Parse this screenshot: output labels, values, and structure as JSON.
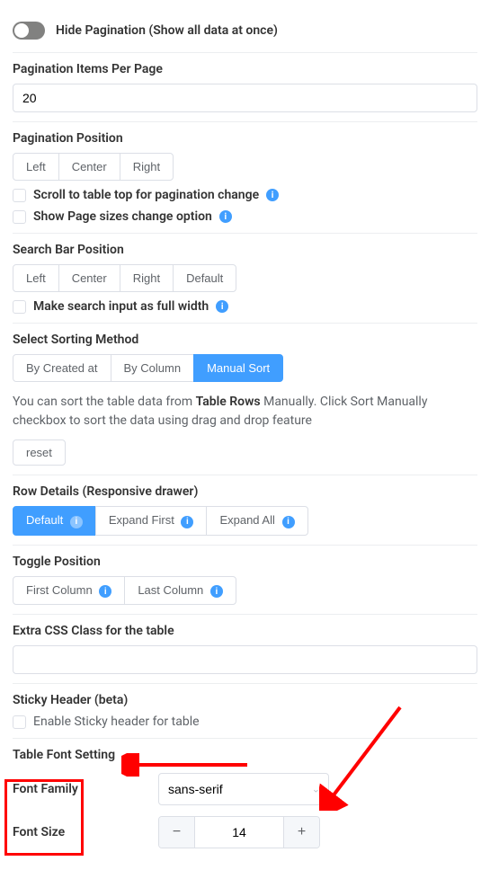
{
  "hidePagination": {
    "label": "Hide Pagination (Show all data at once)"
  },
  "itemsPerPage": {
    "label": "Pagination Items Per Page",
    "value": "20"
  },
  "paginationPosition": {
    "label": "Pagination Position",
    "options": [
      "Left",
      "Center",
      "Right"
    ]
  },
  "scrollTop": {
    "label": "Scroll to table top for pagination change"
  },
  "pageSizes": {
    "label": "Show Page sizes change option"
  },
  "searchBar": {
    "label": "Search Bar Position",
    "options": [
      "Left",
      "Center",
      "Right",
      "Default"
    ]
  },
  "searchFullWidth": {
    "label": "Make search input as full width"
  },
  "sorting": {
    "label": "Select Sorting Method",
    "options": [
      "By Created at",
      "By Column",
      "Manual Sort"
    ],
    "helpPrefix": "You can sort the table data from ",
    "helpBold": "Table Rows",
    "helpSuffix": " Manually. Click Sort Manually checkbox to sort the data using drag and drop feature",
    "reset": "reset"
  },
  "rowDetails": {
    "label": "Row Details (Responsive drawer)",
    "options": [
      "Default",
      "Expand First",
      "Expand All"
    ]
  },
  "togglePosition": {
    "label": "Toggle Position",
    "options": [
      "First Column",
      "Last Column"
    ]
  },
  "extraCss": {
    "label": "Extra CSS Class for the table",
    "value": ""
  },
  "stickyHeader": {
    "label": "Sticky Header (beta)",
    "checkbox": "Enable Sticky header for table"
  },
  "fontSetting": {
    "label": "Table Font Setting",
    "familyLabel": "Font Family",
    "familyValue": "sans-serif",
    "sizeLabel": "Font Size",
    "sizeValue": "14"
  }
}
